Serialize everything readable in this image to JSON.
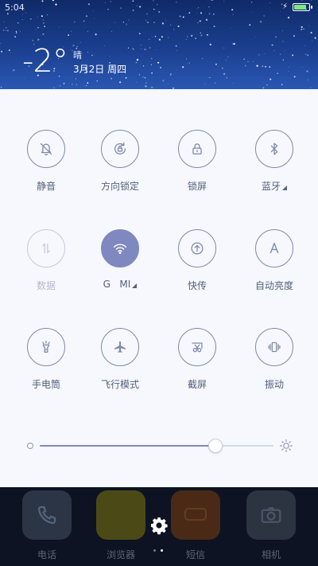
{
  "status_bar": {
    "time": "5:04",
    "battery_level": 0.9,
    "charging_icon": "bolt-icon"
  },
  "weather": {
    "temperature": "-2°",
    "condition": "晴",
    "date": "3月2日 周四"
  },
  "toggles": [
    {
      "label": "静音",
      "icon": "bell-off-icon",
      "state": "off"
    },
    {
      "label": "方向锁定",
      "icon": "rotation-lock-icon",
      "state": "off"
    },
    {
      "label": "锁屏",
      "icon": "lock-icon",
      "state": "off"
    },
    {
      "label": "蓝牙",
      "icon": "bluetooth-icon",
      "state": "off",
      "has_more": true
    },
    {
      "label": "数据",
      "icon": "mobile-data-icon",
      "state": "disabled"
    },
    {
      "label": "G   MI",
      "icon": "wifi-icon",
      "state": "on",
      "has_more": true
    },
    {
      "label": "快传",
      "icon": "transfer-icon",
      "state": "off"
    },
    {
      "label": "自动亮度",
      "icon": "auto-brightness-icon",
      "state": "off"
    },
    {
      "label": "手电筒",
      "icon": "flashlight-icon",
      "state": "off"
    },
    {
      "label": "飞行模式",
      "icon": "airplane-icon",
      "state": "off"
    },
    {
      "label": "截屏",
      "icon": "screenshot-icon",
      "state": "off"
    },
    {
      "label": "振动",
      "icon": "vibrate-icon",
      "state": "off"
    }
  ],
  "brightness": {
    "level": 0.75
  },
  "dock": [
    {
      "label": "电话",
      "icon": "phone-icon",
      "color": "#3a4a5e"
    },
    {
      "label": "浏览器",
      "icon": "browser-icon",
      "color": "#6a6a1a"
    },
    {
      "label": "短信",
      "icon": "message-icon",
      "color": "#6a3418"
    },
    {
      "label": "相机",
      "icon": "camera-icon",
      "color": "#3a4250"
    }
  ],
  "colors": {
    "accent": "#7f88bf",
    "header": "#1b3f8f",
    "panel": "#f6f8fd"
  }
}
